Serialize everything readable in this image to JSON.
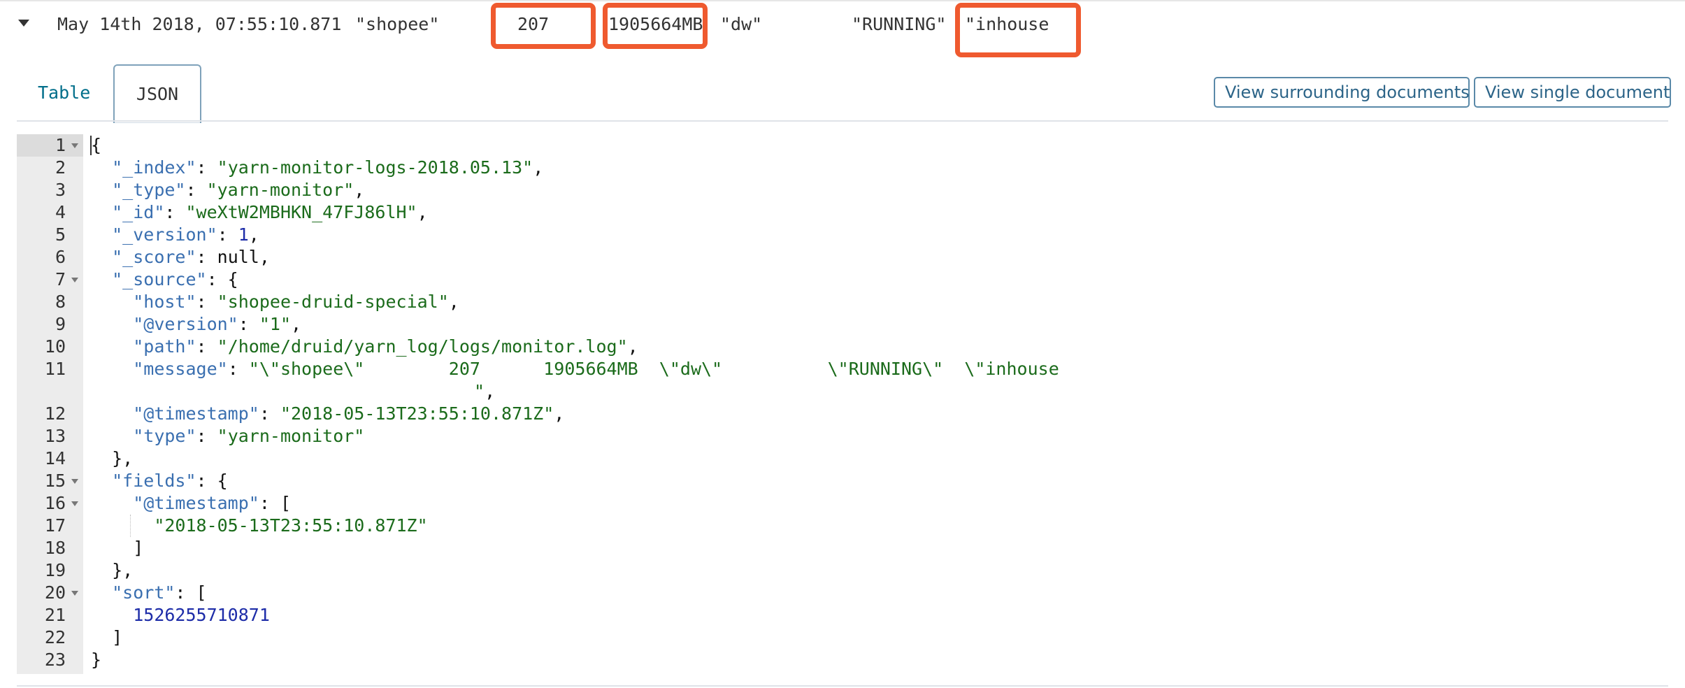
{
  "row": {
    "timestamp": "May 14th 2018, 07:55:10.871",
    "col_user": "\"shopee\"",
    "col_count": "207",
    "col_memory": "1905664MB",
    "col_queue": "\"dw\"",
    "col_state": "\"RUNNING\"",
    "col_type": "\"inhouse"
  },
  "tabs": {
    "table": "Table",
    "json": "JSON"
  },
  "buttons": {
    "surrounding": "View surrounding documents",
    "single": "View single document"
  },
  "editor": {
    "line_numbers": [
      "1",
      "2",
      "3",
      "4",
      "5",
      "6",
      "7",
      "8",
      "9",
      "10",
      "11",
      "12",
      "13",
      "14",
      "15",
      "16",
      "17",
      "18",
      "19",
      "20",
      "21",
      "22",
      "23"
    ],
    "lines": {
      "l1": {
        "p1": "{"
      },
      "l2": {
        "k": "\"_index\"",
        "p": ": ",
        "v": "\"yarn-monitor-logs-2018.05.13\"",
        "e": ","
      },
      "l3": {
        "k": "\"_type\"",
        "p": ": ",
        "v": "\"yarn-monitor\"",
        "e": ","
      },
      "l4": {
        "k": "\"_id\"",
        "p": ": ",
        "v": "\"weXtW2MBHKN_47FJ86lH\"",
        "e": ","
      },
      "l5": {
        "k": "\"_version\"",
        "p": ": ",
        "v": "1",
        "e": ","
      },
      "l6": {
        "k": "\"_score\"",
        "p": ": ",
        "v": "null",
        "e": ","
      },
      "l7": {
        "k": "\"_source\"",
        "p": ": {"
      },
      "l8": {
        "k": "\"host\"",
        "p": ": ",
        "v": "\"shopee-druid-special\"",
        "e": ","
      },
      "l9": {
        "k": "\"@version\"",
        "p": ": ",
        "v": "\"1\"",
        "e": ","
      },
      "l10": {
        "k": "\"path\"",
        "p": ": ",
        "v": "\"/home/druid/yarn_log/logs/monitor.log\"",
        "e": ","
      },
      "l11": {
        "k": "\"message\"",
        "p": ": ",
        "v": "\"\\\"shopee\\\"        207      1905664MB  \\\"dw\\\"          \\\"RUNNING\\\"  \\\"inhouse",
        "wrap": "\"",
        "e": ","
      },
      "l12": {
        "k": "\"@timestamp\"",
        "p": ": ",
        "v": "\"2018-05-13T23:55:10.871Z\"",
        "e": ","
      },
      "l13": {
        "k": "\"type\"",
        "p": ": ",
        "v": "\"yarn-monitor\""
      },
      "l14": {
        "p1": "},"
      },
      "l15": {
        "k": "\"fields\"",
        "p": ": {"
      },
      "l16": {
        "k": "\"@timestamp\"",
        "p": ": ["
      },
      "l17": {
        "v": "\"2018-05-13T23:55:10.871Z\""
      },
      "l18": {
        "p1": "]"
      },
      "l19": {
        "p1": "},"
      },
      "l20": {
        "k": "\"sort\"",
        "p": ": ["
      },
      "l21": {
        "v": "1526255710871"
      },
      "l22": {
        "p1": "]"
      },
      "l23": {
        "p1": "}"
      }
    }
  }
}
